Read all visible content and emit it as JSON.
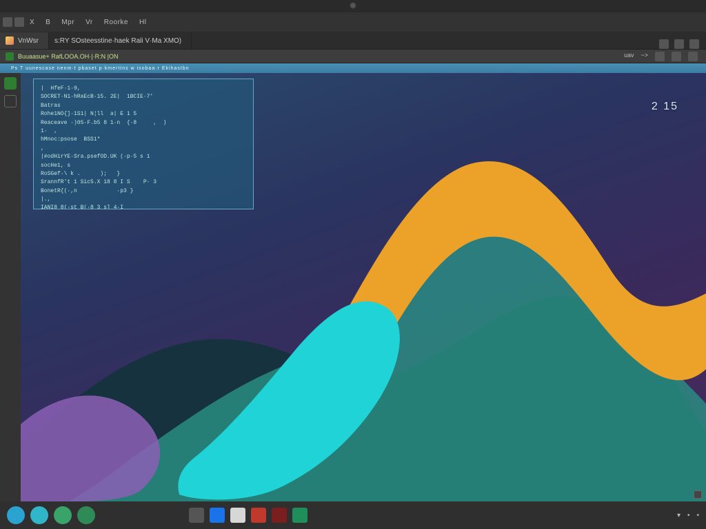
{
  "menu": {
    "items": [
      "X",
      "B",
      "Mpr",
      "Vr",
      "Roorke",
      "Hl"
    ]
  },
  "tabs": [
    {
      "label": "VnWsr",
      "active": true
    },
    {
      "label": "s:RY  SOsteesstine·haek  Rali  V·Ma  XMO)",
      "active": false
    }
  ],
  "secbar": {
    "label": "Buuaasue+  RafLOOA.OH·|·R:N     |ON",
    "right": [
      "uav",
      "~>"
    ]
  },
  "hintbar": {
    "text": "Ps   T uunescase nenm·t pbaset p·kmerttns  w isobaa·r Ekihastbn"
  },
  "terminal_lines": [
    "|  HfeF·1·9,",
    "SOCRET·N1·hRaEcB·15. 2E|  1BCIE·7'",
    "Batras",
    "Rohe1NO{]·1S1| N¦ll  a| E 1 5",
    "Reaceave ·)05·F.b5 8 1·n  {·8     ,  )",
    "1·  ,",
    "hMnoc:psose  BSS1*",
    ",",
    "|#odHirYE·Sra.psefOD.UK (·p·5 s 1",
    "socHe1, s",
    "RoSGef·\\ k .      );   }",
    "SrannfR't 1 Sic5.X 18 8 I S    P· 3",
    "BonetR{(·,n            ·p3 }",
    "|.,",
    "IANI8 8(·st B(·8 3 s] 4·I"
  ],
  "readout": "2 15",
  "taskbar": {
    "pins": [
      {
        "shape": "circle",
        "color": "#2aa3d1"
      },
      {
        "shape": "circle",
        "color": "#31b6c9"
      },
      {
        "shape": "circle",
        "color": "#3aa36a"
      },
      {
        "shape": "circle",
        "color": "#2e8b57"
      }
    ],
    "center": [
      {
        "color": "#555"
      },
      {
        "color": "#1a73e8"
      },
      {
        "color": "#d7d7d7"
      },
      {
        "color": "#c0392b"
      },
      {
        "color": "#7a1f1f"
      },
      {
        "color": "#1e8e5a"
      }
    ],
    "tray": [
      "▾",
      "•",
      "•"
    ]
  },
  "colors": {
    "wave_back": "#16323f",
    "wave_teal": "#2a9084",
    "wave_orange": "#eca229",
    "wave_cyan": "#1fd3d6",
    "wave_purple": "#8c5fb5"
  }
}
